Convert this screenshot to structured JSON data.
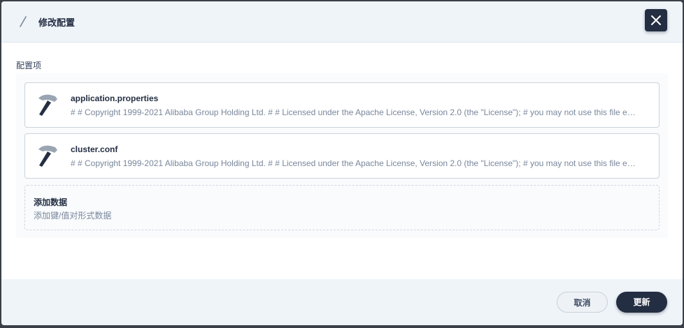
{
  "header": {
    "title": "修改配置",
    "icon": "pencil-icon",
    "close_icon": "close-icon"
  },
  "section": {
    "label": "配置项"
  },
  "config_items": [
    {
      "name": "application.properties",
      "description": "# # Copyright 1999-2021 Alibaba Group Holding Ltd. # # Licensed under the Apache License, Version 2.0 (the \"License\"); # you may not use this file except in compliance with the License.",
      "icon": "hammer-icon"
    },
    {
      "name": "cluster.conf",
      "description": "# # Copyright 1999-2021 Alibaba Group Holding Ltd. # # Licensed under the Apache License, Version 2.0 (the \"License\"); # you may not use this file except in compliance with the License.",
      "icon": "hammer-icon"
    }
  ],
  "add_data": {
    "title": "添加数据",
    "description": "添加键/值对形式数据"
  },
  "footer": {
    "cancel_label": "取消",
    "update_label": "更新"
  },
  "colors": {
    "primary_dark": "#242e42",
    "header_bg": "#eff4f9",
    "muted_text": "#79879c"
  }
}
